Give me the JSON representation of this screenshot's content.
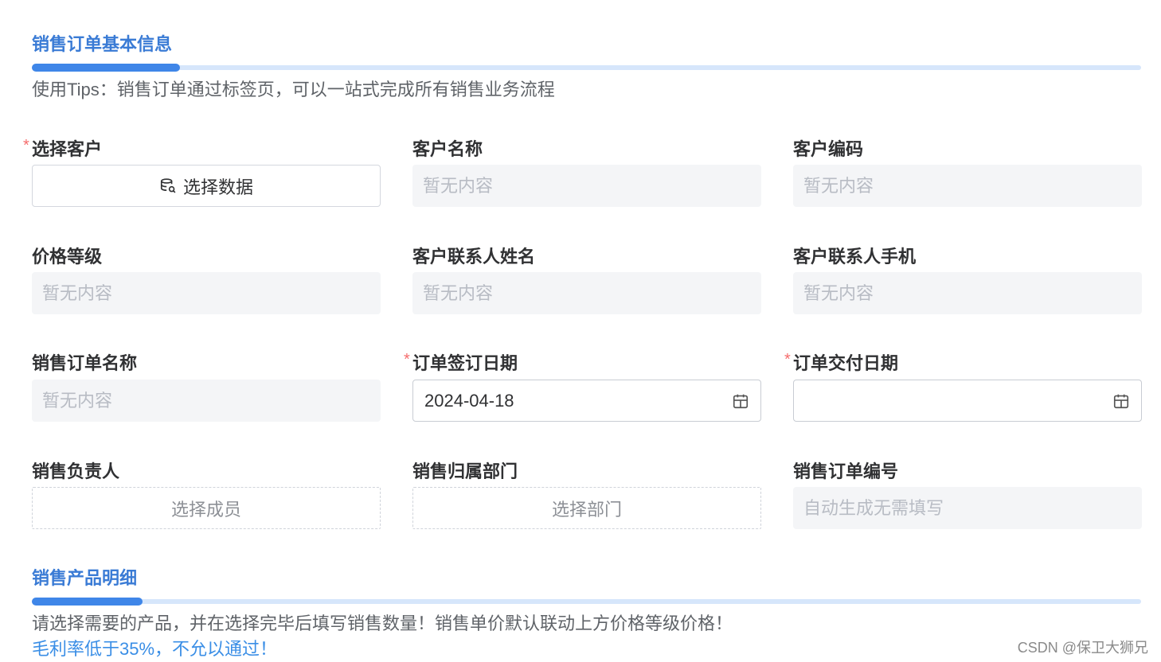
{
  "section1": {
    "title": "销售订单基本信息",
    "tip": "使用Tips：销售订单通过标签页，可以一站式完成所有销售业务流程"
  },
  "fields": {
    "select_customer": {
      "label": "选择客户",
      "required": "*",
      "button": "选择数据",
      "icon": "database-icon"
    },
    "customer_name": {
      "label": "客户名称",
      "value": "暂无内容"
    },
    "customer_code": {
      "label": "客户编码",
      "value": "暂无内容"
    },
    "price_level": {
      "label": "价格等级",
      "value": "暂无内容"
    },
    "contact_name": {
      "label": "客户联系人姓名",
      "value": "暂无内容"
    },
    "contact_phone": {
      "label": "客户联系人手机",
      "value": "暂无内容"
    },
    "order_name": {
      "label": "销售订单名称",
      "value": "暂无内容"
    },
    "sign_date": {
      "label": "订单签订日期",
      "required": "*",
      "value": "2024-04-18",
      "icon": "calendar-icon"
    },
    "delivery_date": {
      "label": "订单交付日期",
      "required": "*",
      "value": "",
      "icon": "calendar-icon"
    },
    "owner": {
      "label": "销售负责人",
      "button": "选择成员"
    },
    "department": {
      "label": "销售归属部门",
      "button": "选择部门"
    },
    "order_no": {
      "label": "销售订单编号",
      "value": "自动生成无需填写"
    }
  },
  "section2": {
    "title": "销售产品明细",
    "tip": "请选择需要的产品，并在选择完毕后填写销售数量！销售单价默认联动上方价格等级价格！",
    "warning": "毛利率低于35%，不允以通过！"
  },
  "watermark": "CSDN @保卫大狮兄",
  "colors": {
    "accent": "#3f86e8",
    "required": "#f56c6c",
    "readonly_bg": "#f4f5f7"
  }
}
